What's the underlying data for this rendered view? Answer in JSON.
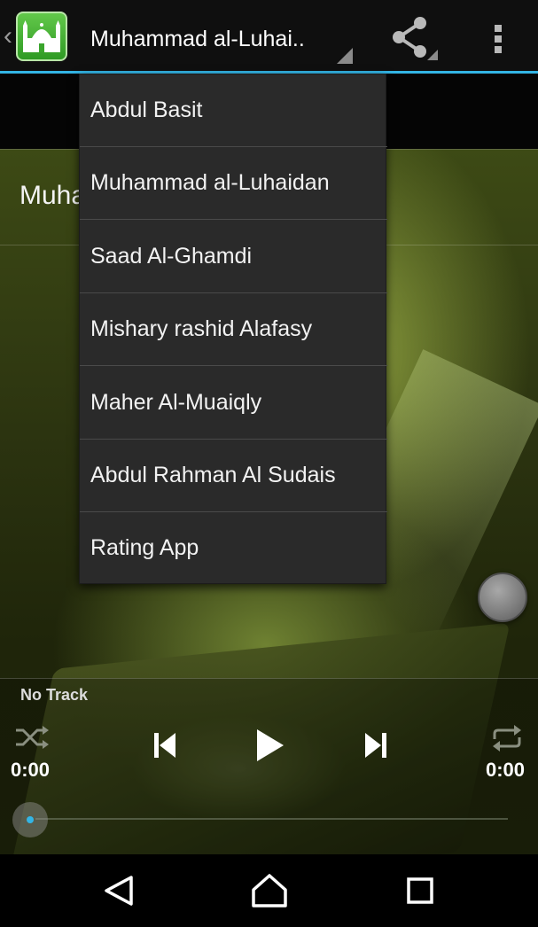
{
  "actionbar": {
    "title": "Muhammad al-Luhai..",
    "app_icon": "mosque-icon",
    "share_icon": "share-icon",
    "overflow_icon": "more-vert-icon",
    "accent_color": "#33b5e5"
  },
  "content": {
    "current_reciter_partial": "Muha"
  },
  "dropdown": {
    "items": [
      {
        "label": "Abdul Basit"
      },
      {
        "label": "Muhammad al-Luhaidan"
      },
      {
        "label": "Saad Al-Ghamdi"
      },
      {
        "label": "Mishary rashid Alafasy"
      },
      {
        "label": "Maher Al-Muaiqly"
      },
      {
        "label": "Abdul Rahman Al Sudais"
      },
      {
        "label": "Rating App"
      }
    ]
  },
  "player": {
    "track_name": "No Track",
    "elapsed": "0:00",
    "duration": "0:00",
    "progress": 0,
    "icons": [
      "shuffle-icon",
      "previous-icon",
      "play-icon",
      "next-icon",
      "repeat-icon"
    ]
  },
  "navbar": {
    "icons": [
      "back-icon",
      "home-icon",
      "recents-icon"
    ]
  }
}
